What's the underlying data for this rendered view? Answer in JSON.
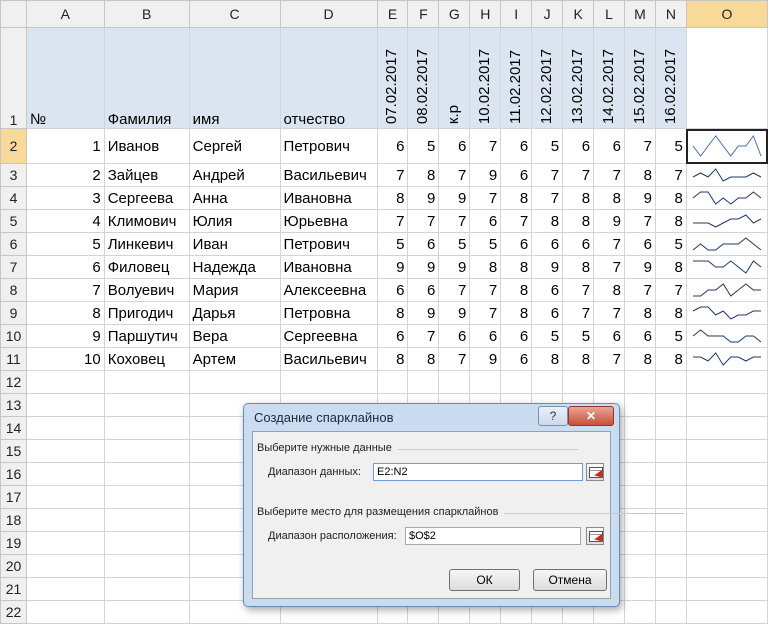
{
  "columns": [
    "A",
    "B",
    "C",
    "D",
    "E",
    "F",
    "G",
    "H",
    "I",
    "J",
    "K",
    "L",
    "M",
    "N",
    "O"
  ],
  "row_numbers": [
    "1",
    "2",
    "3",
    "4",
    "5",
    "6",
    "7",
    "8",
    "9",
    "10",
    "11",
    "12",
    "13",
    "14",
    "15",
    "16",
    "17",
    "18",
    "19",
    "20",
    "21",
    "22"
  ],
  "headers": {
    "num": "№",
    "last": "Фамилия",
    "first": "имя",
    "patronymic": "отчество",
    "dates": [
      "07.02.2017",
      "08.02.2017",
      "к.р",
      "10.02.2017",
      "11.02.2017",
      "12.02.2017",
      "13.02.2017",
      "14.02.2017",
      "15.02.2017",
      "16.02.2017"
    ]
  },
  "students": [
    {
      "num": "1",
      "last": "Иванов",
      "first": "Сергей",
      "patronymic": "Петрович",
      "grades": [
        6,
        5,
        6,
        7,
        6,
        5,
        6,
        6,
        7,
        5
      ]
    },
    {
      "num": "2",
      "last": "Зайцев",
      "first": "Андрей",
      "patronymic": "Васильевич",
      "grades": [
        7,
        8,
        7,
        9,
        6,
        7,
        7,
        7,
        8,
        7
      ]
    },
    {
      "num": "3",
      "last": "Сергеева",
      "first": "Анна",
      "patronymic": "Ивановна",
      "grades": [
        8,
        9,
        9,
        7,
        8,
        7,
        8,
        8,
        9,
        8
      ]
    },
    {
      "num": "4",
      "last": "Климович",
      "first": "Юлия",
      "patronymic": "Юрьевна",
      "grades": [
        7,
        7,
        7,
        6,
        7,
        8,
        8,
        9,
        7,
        8
      ]
    },
    {
      "num": "5",
      "last": "Линкевич",
      "first": "Иван",
      "patronymic": "Петрович",
      "grades": [
        5,
        6,
        5,
        5,
        6,
        6,
        6,
        7,
        6,
        5
      ]
    },
    {
      "num": "6",
      "last": "Филовец",
      "first": "Надежда",
      "patronymic": "Ивановна",
      "grades": [
        9,
        9,
        9,
        8,
        8,
        9,
        8,
        7,
        9,
        8
      ]
    },
    {
      "num": "7",
      "last": "Волуевич",
      "first": "Мария",
      "patronymic": "Алексеевна",
      "grades": [
        6,
        6,
        7,
        7,
        8,
        6,
        7,
        8,
        7,
        7
      ]
    },
    {
      "num": "8",
      "last": "Пригодич",
      "first": "Дарья",
      "patronymic": "Петровна",
      "grades": [
        8,
        9,
        9,
        7,
        8,
        6,
        7,
        7,
        8,
        8
      ]
    },
    {
      "num": "9",
      "last": "Паршутич",
      "first": "Вера",
      "patronymic": "Сергеевна",
      "grades": [
        6,
        7,
        6,
        6,
        6,
        5,
        5,
        6,
        6,
        5
      ]
    },
    {
      "num": "10",
      "last": "Коховец",
      "first": "Артем",
      "patronymic": "Васильевич",
      "grades": [
        8,
        8,
        7,
        9,
        6,
        8,
        8,
        7,
        8,
        8
      ]
    }
  ],
  "colors": {
    "header_fill": "#dbe5f1",
    "selection_header": "#f9d99a",
    "sparkline": "#1f3864",
    "sparkline_active": "#4a6fa5"
  },
  "dialog": {
    "title": "Создание спарклайнов",
    "help_button": "?",
    "close_icon": "close-icon",
    "section_data": "Выберите нужные данные",
    "data_range_label": "Диапазон данных:",
    "data_range_value": "E2:N2",
    "section_location": "Выберите место для размещения спарклайнов",
    "location_range_label": "Диапазон расположения:",
    "location_range_value": "$O$2",
    "ok": "ОК",
    "cancel": "Отмена"
  }
}
